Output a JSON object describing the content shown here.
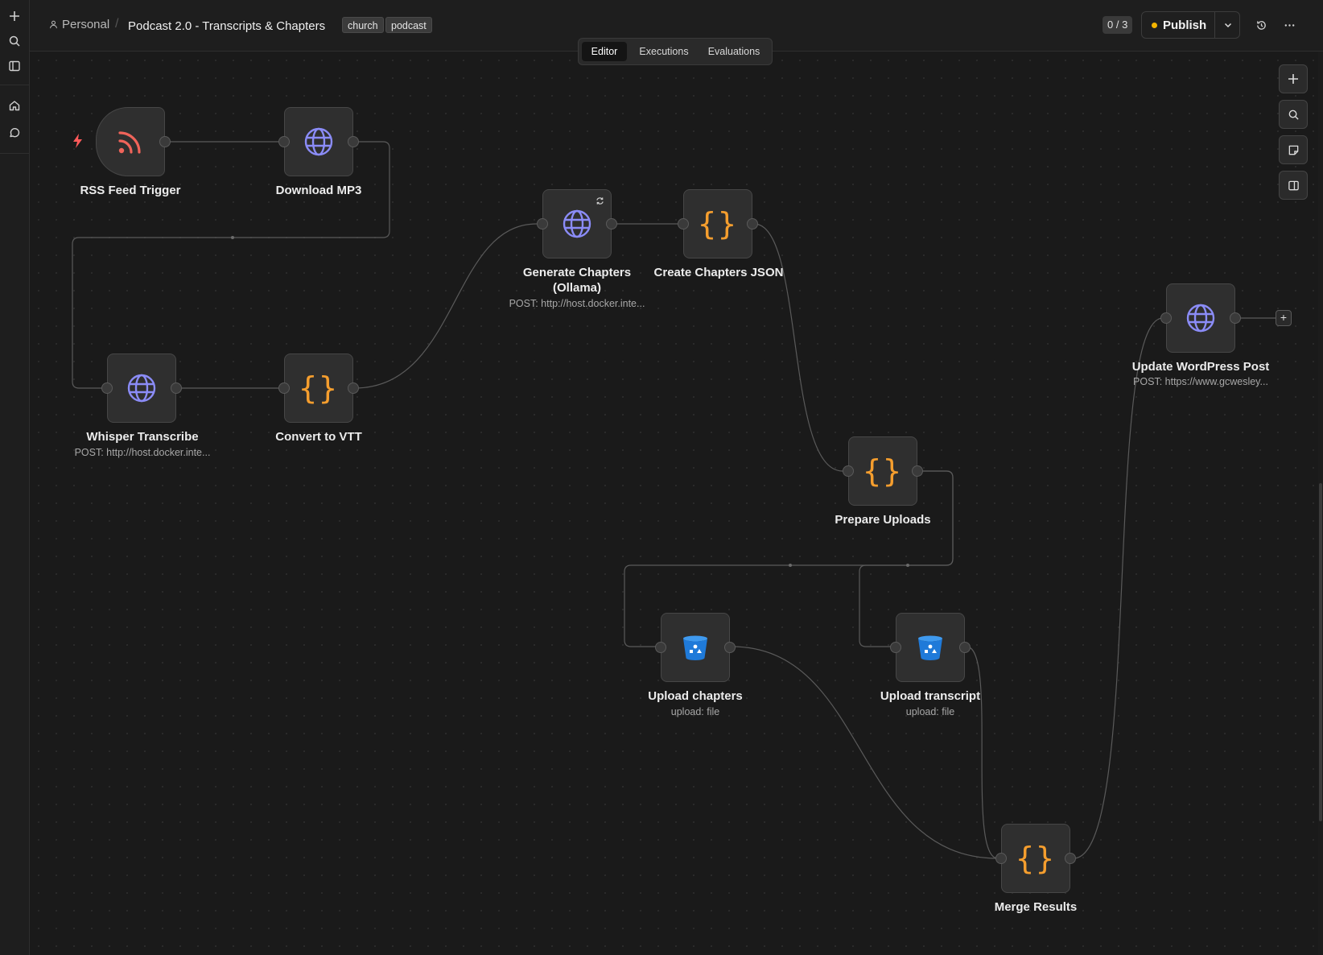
{
  "header": {
    "breadcrumb_personal": "Personal",
    "workflow_title": "Podcast 2.0 - Transcripts & Chapters",
    "tags": [
      "church",
      "podcast"
    ],
    "counter": "0 / 3",
    "publish_label": "Publish",
    "status_color": "#f3b400"
  },
  "tabs": [
    {
      "label": "Editor",
      "active": true
    },
    {
      "label": "Executions",
      "active": false
    },
    {
      "label": "Evaluations",
      "active": false
    }
  ],
  "nodes": {
    "rss_feed_trigger": {
      "label": "RSS Feed Trigger",
      "icon": "rss-icon"
    },
    "download_mp3": {
      "label": "Download MP3",
      "icon": "globe-icon"
    },
    "whisper_transcribe": {
      "label": "Whisper Transcribe",
      "subtitle": "POST: http://host.docker.inte...",
      "icon": "globe-icon"
    },
    "convert_to_vtt": {
      "label": "Convert to VTT",
      "icon": "code-braces-icon"
    },
    "generate_chapters": {
      "label_line1": "Generate Chapters",
      "label_line2": "(Ollama)",
      "subtitle": "POST: http://host.docker.inte...",
      "icon": "globe-icon"
    },
    "create_chapters_json": {
      "label": "Create Chapters JSON",
      "icon": "code-braces-icon"
    },
    "prepare_uploads": {
      "label": "Prepare Uploads",
      "icon": "code-braces-icon"
    },
    "upload_chapters": {
      "label": "Upload chapters",
      "subtitle": "upload: file",
      "icon": "bucket-icon"
    },
    "upload_transcript": {
      "label": "Upload transcript",
      "subtitle": "upload: file",
      "icon": "bucket-icon"
    },
    "merge_results": {
      "label": "Merge Results",
      "icon": "code-braces-icon"
    },
    "update_wordpress_post": {
      "label": "Update WordPress Post",
      "subtitle": "POST: https://www.gcwesley...",
      "icon": "globe-icon"
    }
  },
  "icons": {
    "code_braces": "{}",
    "plus": "+"
  },
  "colors": {
    "globe": "#8b8cf7",
    "braces": "#f59e2e",
    "rss": "#f0645a",
    "bucket": "#1f7ad9",
    "trigger_bolt": "#ff5a5a"
  }
}
